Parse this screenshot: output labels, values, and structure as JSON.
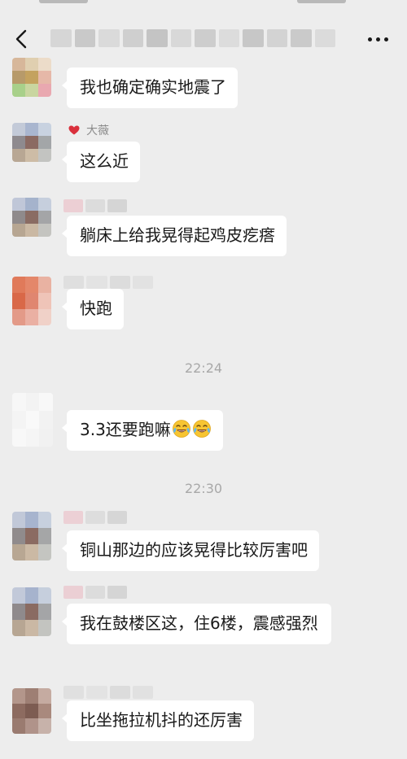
{
  "header": {
    "back_icon": "chevron-left-icon",
    "more_icon": "more-dots-icon"
  },
  "messages": [
    {
      "sender": "",
      "text": "我也确定确实地震了"
    },
    {
      "sender": "大薇",
      "text": "这么近"
    },
    {
      "sender": "",
      "text": "躺床上给我晃得起鸡皮疙瘩"
    },
    {
      "sender": "",
      "text": "快跑"
    },
    {
      "sender": "",
      "text": "3.3还要跑嘛",
      "emoji": "tears-of-joy-icon"
    },
    {
      "sender": "",
      "text": "铜山那边的应该晃得比较厉害吧"
    },
    {
      "sender": "",
      "text": "我在鼓楼区这，住6楼，震感强烈"
    },
    {
      "sender": "",
      "text": "比坐拖拉机抖的还厉害"
    }
  ],
  "timestamps": [
    "22:24",
    "22:30"
  ],
  "colors": {
    "background": "#ededed",
    "bubble": "#ffffff",
    "timestamp": "#a8a8a8",
    "nickname": "#8c8c8c",
    "heart": "#d9303c"
  }
}
